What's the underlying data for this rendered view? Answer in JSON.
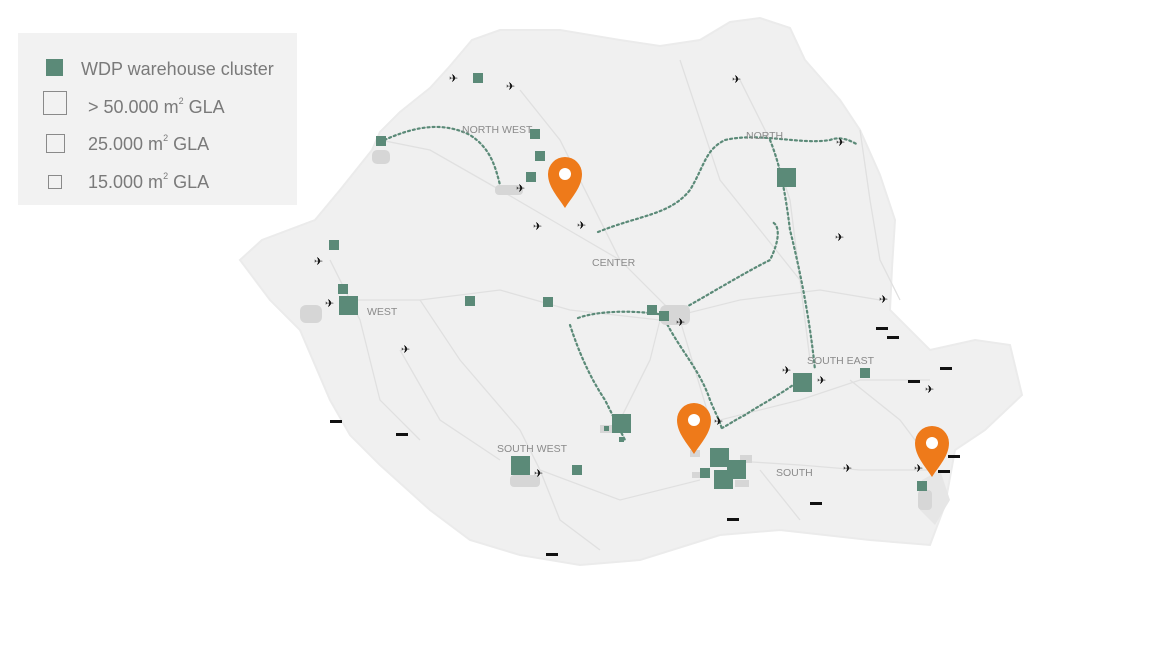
{
  "legend": {
    "cluster_label": "WDP warehouse cluster",
    "size_50k_prefix": "> 50.000 m",
    "size_25k_prefix": "25.000 m",
    "size_15k_prefix": "15.000 m",
    "superscript": "2",
    "gla_suffix": " GLA"
  },
  "regions": {
    "north_west": "NORTH WEST",
    "north": "NORTH",
    "center": "CENTER",
    "west": "WEST",
    "south_east": "SOUTH EAST",
    "south_west": "SOUTH WEST",
    "south": "SOUTH"
  },
  "colors": {
    "cluster": "#5b8a78",
    "pin": "#ee7a1a",
    "road": "#e2e2e2",
    "country": "#efefef"
  },
  "icons": [
    "airport-icon",
    "port-icon",
    "location-pin-icon"
  ]
}
